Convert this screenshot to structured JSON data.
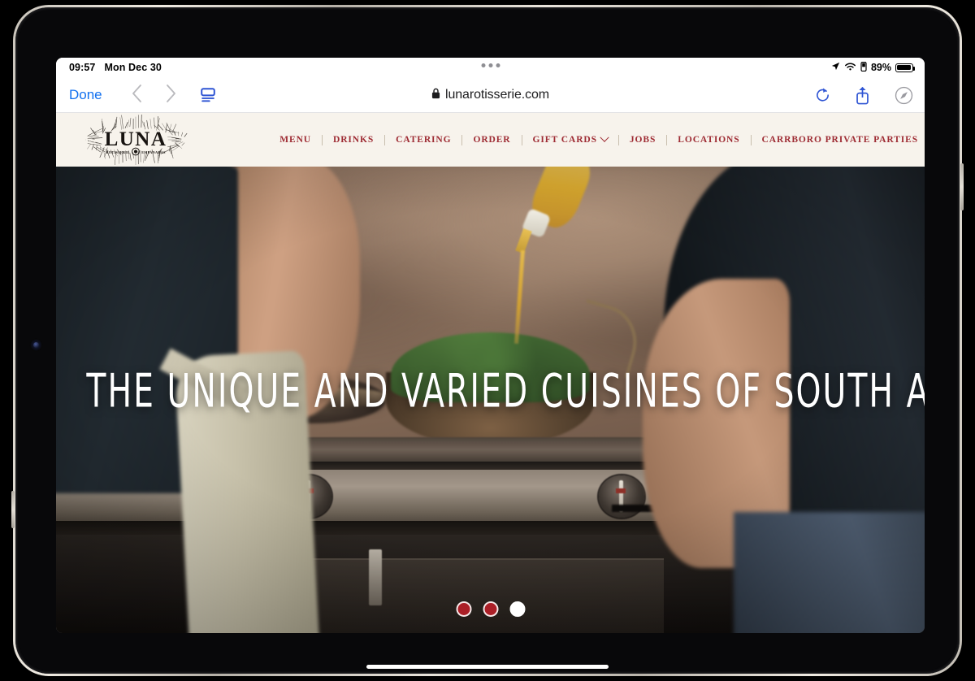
{
  "status_bar": {
    "time": "09:57",
    "date": "Mon Dec 30",
    "battery_percent": "89%",
    "icons": [
      "location-arrow-icon",
      "wifi-icon",
      "cellular-icon",
      "battery-icon"
    ]
  },
  "browser": {
    "done_label": "Done",
    "back_glyph": "‹",
    "forward_glyph": "›",
    "sidebar_icon": "sidebar-icon",
    "lock_icon": "lock-icon",
    "url": "lunarotisserie.com",
    "reload_icon": "reload-icon",
    "share_icon": "share-icon",
    "safari_icon": "compass-icon"
  },
  "site": {
    "logo": {
      "wordmark": "LUNA",
      "tagline_left": "ROTISSERIE",
      "tagline_right": "EMPANADAS"
    },
    "nav": [
      {
        "label": "MENU",
        "has_chevron": false
      },
      {
        "label": "DRINKS",
        "has_chevron": false
      },
      {
        "label": "CATERING",
        "has_chevron": false
      },
      {
        "label": "ORDER",
        "has_chevron": false
      },
      {
        "label": "GIFT CARDS",
        "has_chevron": true
      },
      {
        "label": "JOBS",
        "has_chevron": false
      },
      {
        "label": "LOCATIONS",
        "has_chevron": false
      },
      {
        "label": "CARRBORO PRIVATE PARTIES",
        "has_chevron": false
      }
    ],
    "hero": {
      "headline": "THE UNIQUE AND VARIED CUISINES OF SOUTH AMERICA",
      "slides": [
        {
          "state": "inactive"
        },
        {
          "state": "inactive"
        },
        {
          "state": "active"
        }
      ]
    },
    "colors": {
      "header_background": "#f7f3ec",
      "nav_link": "#9e2b33",
      "dot_inactive": "#ab1f27",
      "dot_active": "#ffffff",
      "browser_accent": "#1170ef"
    }
  }
}
